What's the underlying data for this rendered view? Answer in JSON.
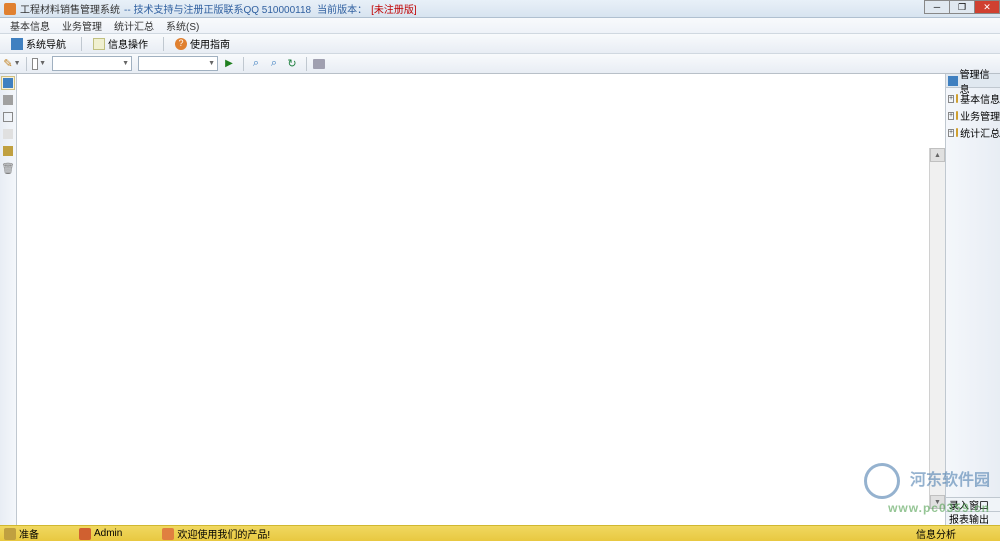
{
  "title": {
    "app_name": "工程材料销售管理系统",
    "subtitle": "-- 技术支持与注册正版联系QQ 510000118",
    "version_label": "当前版本：",
    "unregistered": "[未注册版]"
  },
  "menubar": {
    "basic_info": "基本信息",
    "business_mgmt": "业务管理",
    "stats_summary": "统计汇总",
    "system": "系统(S)"
  },
  "toolbar": {
    "system_nav": "系统导航",
    "info_operate": "信息操作",
    "usage_guide": "使用指南"
  },
  "right_panel": {
    "header": "管理信息",
    "tree": {
      "basic_info": "基本信息",
      "business_mgmt": "业务管理",
      "stats_summary": "统计汇总"
    },
    "bottom_tabs": {
      "entry_window": "录入窗口",
      "report_output": "报表输出"
    }
  },
  "statusbar": {
    "ready": "准备",
    "admin": "Admin",
    "welcome": "欢迎使用我们的产品!",
    "info_analysis": "信息分析"
  },
  "watermark": {
    "site_name": "河东软件园",
    "url": "www.pc0359.cn"
  }
}
